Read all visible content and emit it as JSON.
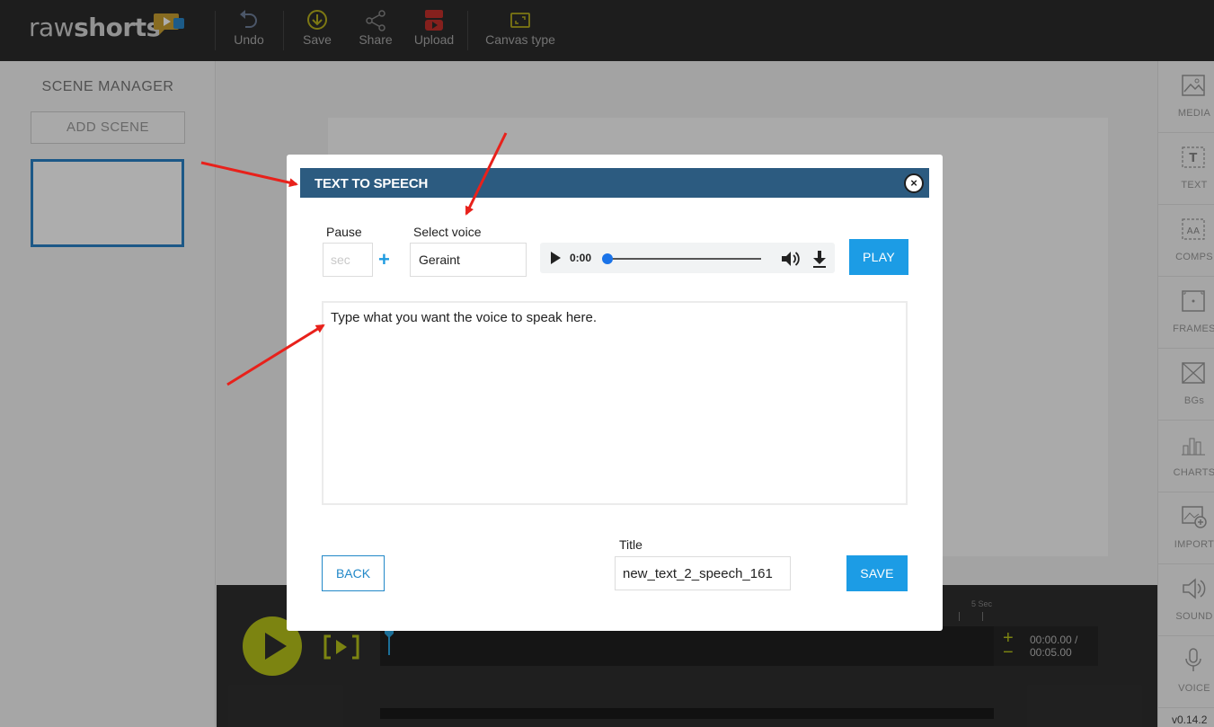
{
  "app": {
    "logo": {
      "part1": "raw",
      "part2": "shorts"
    },
    "toolbar": {
      "undo": "Undo",
      "save": "Save",
      "share": "Share",
      "upload": "Upload",
      "canvas_type": "Canvas type"
    }
  },
  "scene_manager": {
    "title": "SCENE MANAGER",
    "add_scene": "ADD SCENE"
  },
  "right_tools": [
    {
      "label": "MEDIA",
      "icon": "image-icon"
    },
    {
      "label": "TEXT",
      "icon": "text-icon"
    },
    {
      "label": "COMPS",
      "icon": "comps-icon"
    },
    {
      "label": "FRAMES",
      "icon": "frames-icon"
    },
    {
      "label": "BGs",
      "icon": "background-icon"
    },
    {
      "label": "CHARTS",
      "icon": "chart-icon"
    },
    {
      "label": "IMPORT",
      "icon": "import-icon"
    },
    {
      "label": "SOUND",
      "icon": "sound-icon"
    },
    {
      "label": "VOICE",
      "icon": "microphone-icon"
    }
  ],
  "version": "v0.14.2",
  "timeline": {
    "ruler_label": "5 Sec",
    "zoom_in": "+",
    "zoom_out": "−",
    "time_current": "00:00.00 /",
    "time_total": "00:05.00"
  },
  "modal": {
    "title": "TEXT TO SPEECH",
    "close": "×",
    "pause_label": "Pause",
    "pause_placeholder": "sec",
    "pause_add": "+",
    "voice_label": "Select voice",
    "voice_value": "Geraint",
    "audio_time": "0:00",
    "play_button": "PLAY",
    "speech_text": "Type what you want the voice to speak here.",
    "back_button": "BACK",
    "title_label": "Title",
    "title_value": "new_text_2_speech_161",
    "save_button": "SAVE"
  },
  "colors": {
    "accent_blue": "#1c9ce5",
    "header_blue": "#2c5b80",
    "timeline_accent": "#b7c31a",
    "annotation_red": "#e8211b"
  }
}
